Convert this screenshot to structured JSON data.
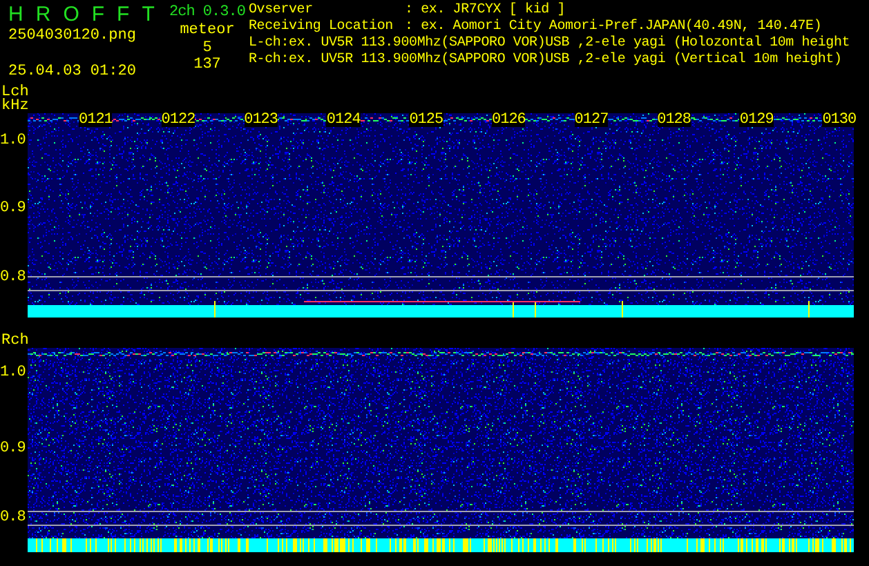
{
  "app": {
    "title_letters": [
      "H",
      "R",
      "O",
      "F",
      "F",
      "T"
    ],
    "version": "2ch 0.3.0",
    "filename": "2504030120.png",
    "datetime": "25.04.03 01:20",
    "counter_label": "meteor",
    "counter_values": [
      "5",
      "137"
    ]
  },
  "info": [
    {
      "label": "Ovserver",
      "value": ": ex. JR7CYX [ kid ]"
    },
    {
      "label": "Receiving Location",
      "value": ": ex. Aomori City Aomori-Pref.JAPAN(40.49N, 140.47E)"
    }
  ],
  "channel_lines": [
    "L-ch:ex. UV5R 113.900Mhz(SAPPORO VOR)USB ,2-ele yagi (Holozontal 10m height",
    "R-ch:ex. UV5R 113.900Mhz(SAPPORO VOR)USB ,2-ele yagi (Vertical 10m height)"
  ],
  "channels": [
    {
      "label": "Lch",
      "unit": "kHz",
      "yticks": [
        "1.0",
        "0.9",
        "0.8"
      ],
      "time_labels": [
        "0121",
        "0122",
        "0123",
        "0124",
        "0125",
        "0126",
        "0127",
        "0128",
        "0129",
        "0130"
      ]
    },
    {
      "label": "Rch",
      "yticks": [
        "1.0",
        "0.9",
        "0.8"
      ]
    }
  ]
}
